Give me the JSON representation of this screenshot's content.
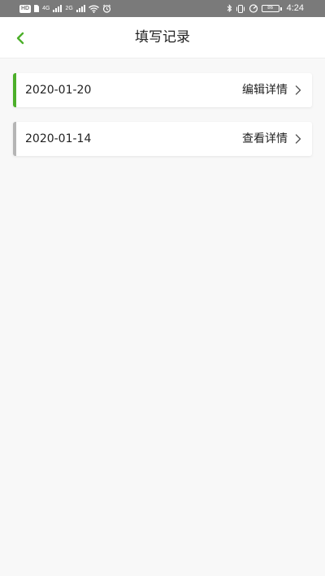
{
  "status_bar": {
    "left_chip": "HD",
    "network_1": "4G",
    "network_2": "2G",
    "battery_level": "86",
    "time": "4:24",
    "background_color": "#7a7a7a"
  },
  "header": {
    "title": "填写记录",
    "back_icon": "chevron-left-icon",
    "accent_color": "#4caf2a"
  },
  "records": [
    {
      "date": "2020-01-20",
      "action_label": "编辑详情",
      "accent_color": "#4caf2a",
      "chevron_icon": "chevron-right-icon"
    },
    {
      "date": "2020-01-14",
      "action_label": "查看详情",
      "accent_color": "#b5b5b5",
      "chevron_icon": "chevron-right-icon"
    }
  ]
}
